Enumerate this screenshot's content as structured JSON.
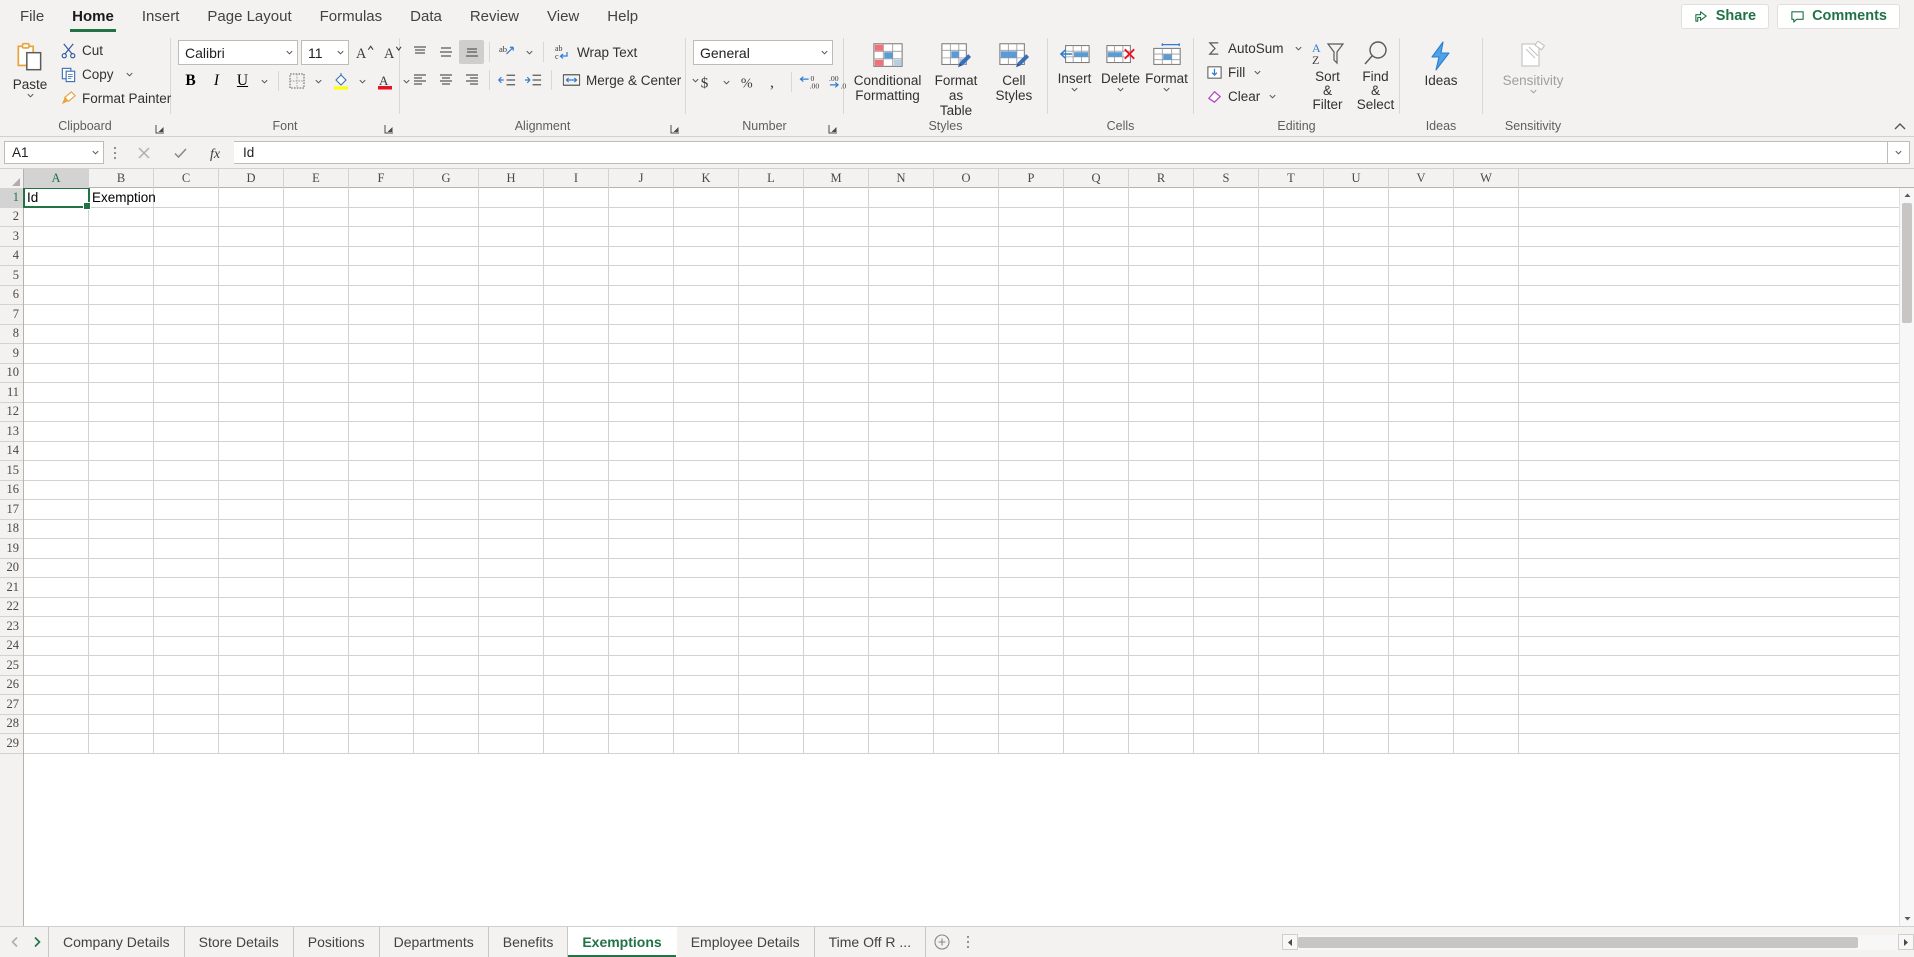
{
  "ribbon_tabs": [
    {
      "label": "File",
      "active": false
    },
    {
      "label": "Home",
      "active": true
    },
    {
      "label": "Insert",
      "active": false
    },
    {
      "label": "Page Layout",
      "active": false
    },
    {
      "label": "Formulas",
      "active": false
    },
    {
      "label": "Data",
      "active": false
    },
    {
      "label": "Review",
      "active": false
    },
    {
      "label": "View",
      "active": false
    },
    {
      "label": "Help",
      "active": false
    }
  ],
  "titlebar": {
    "share_label": "Share",
    "comments_label": "Comments"
  },
  "groups": {
    "clipboard": {
      "label": "Clipboard",
      "paste_label": "Paste",
      "cut_label": "Cut",
      "copy_label": "Copy",
      "format_painter_label": "Format Painter"
    },
    "font": {
      "label": "Font",
      "font_name": "Calibri",
      "font_size": "11"
    },
    "alignment": {
      "label": "Alignment",
      "wrap_text_label": "Wrap Text",
      "merge_center_label": "Merge & Center"
    },
    "number": {
      "label": "Number",
      "format": "General"
    },
    "styles": {
      "label": "Styles",
      "conditional_formatting_label": "Conditional Formatting",
      "format_as_table_label": "Format as Table",
      "cell_styles_label": "Cell Styles"
    },
    "cells": {
      "label": "Cells",
      "insert_label": "Insert",
      "delete_label": "Delete",
      "format_label": "Format"
    },
    "editing": {
      "label": "Editing",
      "autosum_label": "AutoSum",
      "fill_label": "Fill",
      "clear_label": "Clear",
      "sort_filter_label": "Sort & Filter",
      "find_select_label": "Find & Select"
    },
    "ideas": {
      "label": "Ideas",
      "ideas_label": "Ideas"
    },
    "sensitivity": {
      "label": "Sensitivity",
      "sensitivity_label": "Sensitivity"
    }
  },
  "formula_bar": {
    "name_box": "A1",
    "formula_value": "Id"
  },
  "grid": {
    "columns": [
      "A",
      "B",
      "C",
      "D",
      "E",
      "F",
      "G",
      "H",
      "I",
      "J",
      "K",
      "L",
      "M",
      "N",
      "O",
      "P",
      "Q",
      "R",
      "S",
      "T",
      "U",
      "V",
      "W"
    ],
    "selected_column": "A",
    "rows": [
      1,
      2,
      3,
      4,
      5,
      6,
      7,
      8,
      9,
      10,
      11,
      12,
      13,
      14,
      15,
      16,
      17,
      18,
      19,
      20,
      21,
      22,
      23,
      24,
      25,
      26,
      27,
      28,
      29
    ],
    "selected_row": 1,
    "active_cell": "A1",
    "cell_values": {
      "A1": "Id",
      "B1": "Exemption"
    }
  },
  "sheet_tabs": [
    {
      "label": "Company Details",
      "active": false
    },
    {
      "label": "Store Details",
      "active": false
    },
    {
      "label": "Positions",
      "active": false
    },
    {
      "label": "Departments",
      "active": false
    },
    {
      "label": "Benefits",
      "active": false
    },
    {
      "label": "Exemptions",
      "active": true
    },
    {
      "label": "Employee Details",
      "active": false
    },
    {
      "label": "Time Off R ...",
      "active": false
    }
  ],
  "colors": {
    "accent": "#217346",
    "ribbon_bg": "#f3f2f1",
    "header_bg": "#f3f2f1"
  }
}
